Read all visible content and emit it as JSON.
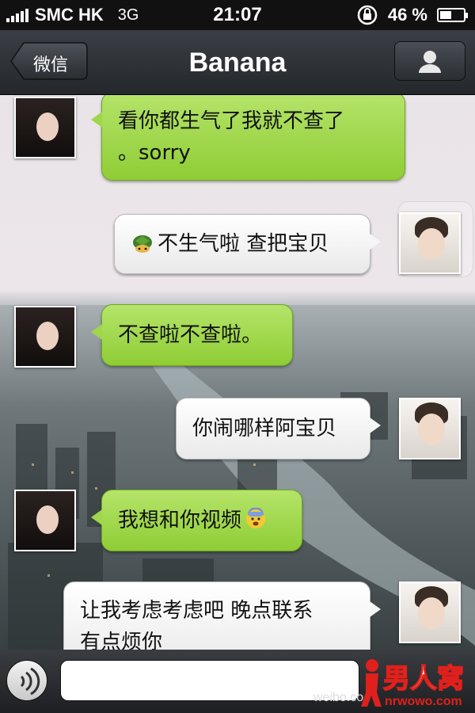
{
  "status_bar": {
    "carrier": "SMC HK",
    "network": "3G",
    "time": "21:07",
    "battery_percent": "46 %",
    "battery_level": 0.46
  },
  "nav": {
    "back_label": "微信",
    "title": "Banana",
    "profile_icon": "person-icon"
  },
  "messages": [
    {
      "sender": "contact",
      "bubble": "green",
      "lines": [
        "看你都生气了我就不查了",
        "。sorry"
      ]
    },
    {
      "sender": "me",
      "bubble": "white",
      "text": "不生气啦 查把宝贝",
      "leading_icon": "turtle-emoji-icon"
    },
    {
      "sender": "contact",
      "bubble": "green",
      "text": "不查啦不查啦。"
    },
    {
      "sender": "me",
      "bubble": "white",
      "text": "你闹哪样阿宝贝"
    },
    {
      "sender": "contact",
      "bubble": "green",
      "text": "我想和你视频",
      "trailing_icon": "fearful-face-emoji-icon"
    },
    {
      "sender": "me",
      "bubble": "white",
      "lines": [
        "让我考虑考虑吧 晚点联系",
        "有点烦你"
      ]
    }
  ],
  "input_bar": {
    "voice_icon": "voice-wave-icon",
    "input_value": ""
  },
  "watermark": {
    "text": "weibo.co",
    "logo_text": "男人窝",
    "logo_url": "nrwowo.com"
  },
  "colors": {
    "green_bubble": "#9fd64b",
    "white_bubble": "#f5f5f5",
    "nav_bg": "#2f3237",
    "logo_red": "#e0201c"
  }
}
